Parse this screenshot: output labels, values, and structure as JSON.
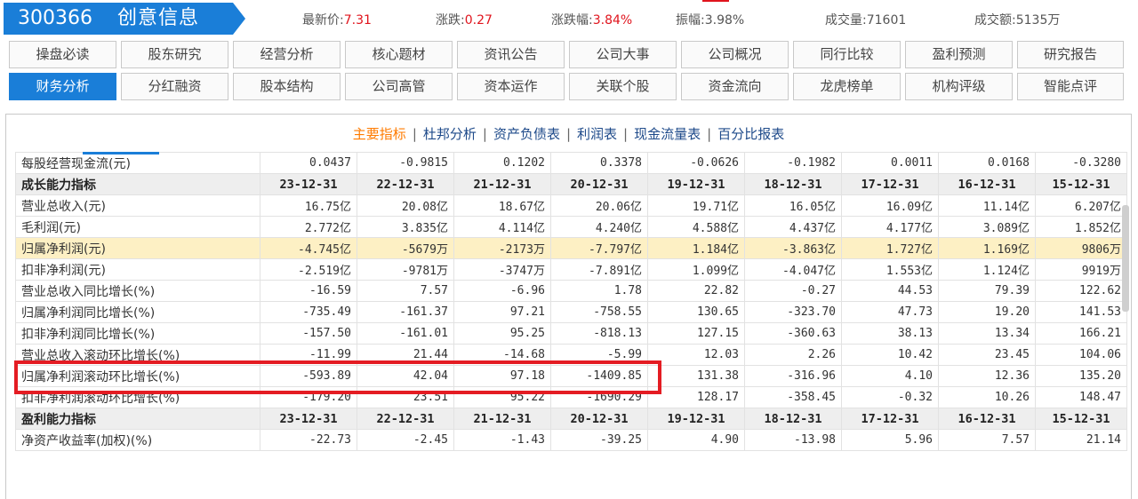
{
  "stock": {
    "code": "300366",
    "name": "创意信息"
  },
  "quote": [
    {
      "label": "最新价:",
      "value": "7.31",
      "color": "#e0141d"
    },
    {
      "label": "涨跌:",
      "value": "0.27",
      "color": "#e0141d"
    },
    {
      "label": "涨跌幅:",
      "value": "3.84%",
      "color": "#e0141d"
    },
    {
      "label": "振幅:",
      "value": "3.98%",
      "color": "#555555"
    },
    {
      "label": "成交量:",
      "value": "71601",
      "color": "#555555"
    },
    {
      "label": "成交额:",
      "value": "5135万",
      "color": "#555555"
    }
  ],
  "tabs_row1": [
    "操盘必读",
    "股东研究",
    "经营分析",
    "核心题材",
    "资讯公告",
    "公司大事",
    "公司概况",
    "同行比较",
    "盈利预测",
    "研究报告"
  ],
  "tabs_row2": [
    "财务分析",
    "分红融资",
    "股本结构",
    "公司高管",
    "资本运作",
    "关联个股",
    "资金流向",
    "龙虎榜单",
    "机构评级",
    "智能点评"
  ],
  "active_tab": "财务分析",
  "subnav": [
    "主要指标",
    "杜邦分析",
    "资产负债表",
    "利润表",
    "现金流量表",
    "百分比报表"
  ],
  "active_subnav": "主要指标",
  "table": [
    {
      "type": "data",
      "label": "每股经营现金流(元)",
      "values": [
        "0.0437",
        "-0.9815",
        "0.1202",
        "0.3378",
        "-0.0626",
        "-0.1982",
        "0.0011",
        "0.0168",
        "-0.3280"
      ]
    },
    {
      "type": "section",
      "label": "成长能力指标",
      "values": [
        "23-12-31",
        "22-12-31",
        "21-12-31",
        "20-12-31",
        "19-12-31",
        "18-12-31",
        "17-12-31",
        "16-12-31",
        "15-12-31"
      ]
    },
    {
      "type": "data",
      "label": "营业总收入(元)",
      "values": [
        "16.75亿",
        "20.08亿",
        "18.67亿",
        "20.06亿",
        "19.71亿",
        "16.05亿",
        "16.09亿",
        "11.14亿",
        "6.207亿"
      ]
    },
    {
      "type": "data",
      "label": "毛利润(元)",
      "values": [
        "2.772亿",
        "3.835亿",
        "4.114亿",
        "4.240亿",
        "4.588亿",
        "4.437亿",
        "4.177亿",
        "3.089亿",
        "1.852亿"
      ]
    },
    {
      "type": "highlight",
      "label": "归属净利润(元)",
      "values": [
        "-4.745亿",
        "-5679万",
        "-2173万",
        "-7.797亿",
        "1.184亿",
        "-3.863亿",
        "1.727亿",
        "1.169亿",
        "9806万"
      ]
    },
    {
      "type": "data",
      "label": "扣非净利润(元)",
      "values": [
        "-2.519亿",
        "-9781万",
        "-3747万",
        "-7.891亿",
        "1.099亿",
        "-4.047亿",
        "1.553亿",
        "1.124亿",
        "9919万"
      ]
    },
    {
      "type": "data",
      "label": "营业总收入同比增长(%)",
      "values": [
        "-16.59",
        "7.57",
        "-6.96",
        "1.78",
        "22.82",
        "-0.27",
        "44.53",
        "79.39",
        "122.62"
      ]
    },
    {
      "type": "data",
      "label": "归属净利润同比增长(%)",
      "values": [
        "-735.49",
        "-161.37",
        "97.21",
        "-758.55",
        "130.65",
        "-323.70",
        "47.73",
        "19.20",
        "141.53"
      ]
    },
    {
      "type": "data",
      "label": "扣非净利润同比增长(%)",
      "values": [
        "-157.50",
        "-161.01",
        "95.25",
        "-818.13",
        "127.15",
        "-360.63",
        "38.13",
        "13.34",
        "166.21"
      ]
    },
    {
      "type": "data",
      "label": "营业总收入滚动环比增长(%)",
      "values": [
        "-11.99",
        "21.44",
        "-14.68",
        "-5.99",
        "12.03",
        "2.26",
        "10.42",
        "23.45",
        "104.06"
      ]
    },
    {
      "type": "data",
      "label": "归属净利润滚动环比增长(%)",
      "values": [
        "-593.89",
        "42.04",
        "97.18",
        "-1409.85",
        "131.38",
        "-316.96",
        "4.10",
        "12.36",
        "135.20"
      ]
    },
    {
      "type": "data",
      "label": "扣非净利润滚动环比增长(%)",
      "values": [
        "-179.20",
        "23.51",
        "95.22",
        "-1690.29",
        "128.17",
        "-358.45",
        "-0.32",
        "10.26",
        "148.47"
      ]
    },
    {
      "type": "section",
      "label": "盈利能力指标",
      "values": [
        "23-12-31",
        "22-12-31",
        "21-12-31",
        "20-12-31",
        "19-12-31",
        "18-12-31",
        "17-12-31",
        "16-12-31",
        "15-12-31"
      ]
    },
    {
      "type": "data",
      "label": "净资产收益率(加权)(%)",
      "values": [
        "-22.73",
        "-2.45",
        "-1.43",
        "-39.25",
        "4.90",
        "-13.98",
        "5.96",
        "7.57",
        "21.14"
      ]
    }
  ]
}
